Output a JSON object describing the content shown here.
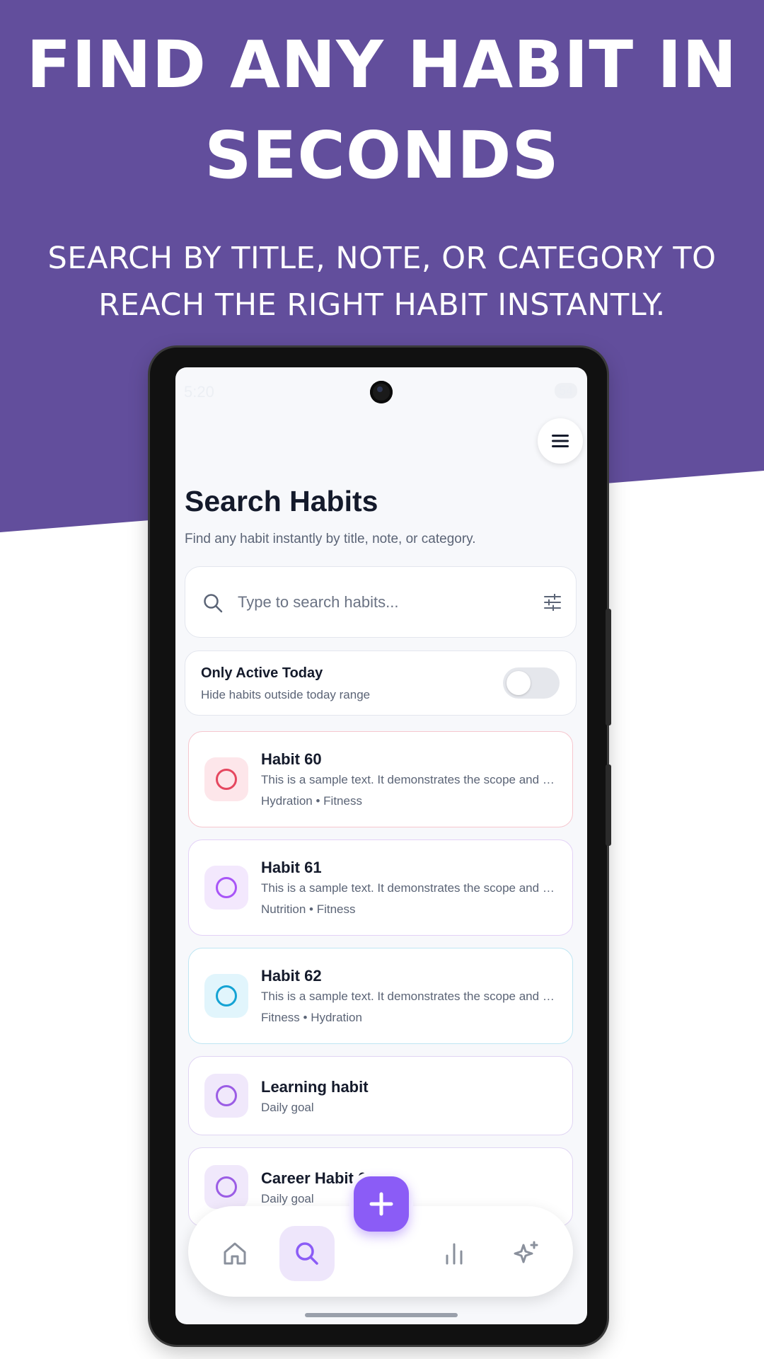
{
  "hero": {
    "title_line1": "FIND ANY HABIT IN",
    "title_line2": "SECONDS",
    "subtitle_line1": "SEARCH BY TITLE, NOTE, OR CATEGORY TO",
    "subtitle_line2": "REACH THE RIGHT HABIT INSTANTLY."
  },
  "status_bar": {
    "time": "5:20",
    "battery": "54"
  },
  "screen": {
    "title": "Search Habits",
    "subtitle": "Find any habit instantly by title, note, or category."
  },
  "search": {
    "value": "",
    "placeholder": "Type to search habits..."
  },
  "filter": {
    "title": "Only Active Today",
    "subtitle": "Hide habits outside today range",
    "enabled": false
  },
  "habits": [
    {
      "title": "Habit 60",
      "description": "This is a sample text. It demonstrates the scope and purpose of this habit.",
      "tags": "Hydration • Fitness",
      "accent": "#e5475f",
      "badge_bg": "#fde6ea",
      "border": "#f6c6ce"
    },
    {
      "title": "Habit 61",
      "description": "This is a sample text. It demonstrates the scope and purpose of this habit.",
      "tags": "Nutrition • Fitness",
      "accent": "#a855f7",
      "badge_bg": "#f3e8fd",
      "border": "#e3d2f7"
    },
    {
      "title": "Habit 62",
      "description": "This is a sample text. It demonstrates the scope and purpose of this habit.",
      "tags": "Fitness • Hydration",
      "accent": "#14a3d4",
      "badge_bg": "#e1f5fc",
      "border": "#bfe6f3"
    },
    {
      "title": "Learning habit",
      "description": "Daily goal",
      "accent": "#9b5de5",
      "badge_bg": "#f0e8fb",
      "border": "#e0d5f3"
    },
    {
      "title": "Career Habit 6",
      "description": "Daily goal",
      "accent": "#9b5de5",
      "badge_bg": "#f0e8fb",
      "border": "#e0d5f3"
    }
  ],
  "nav": {
    "items": [
      "home-icon",
      "search-icon",
      "chart-icon",
      "sparkles-icon"
    ],
    "active": "search-icon",
    "accent": "#8b5cf6"
  },
  "colors": {
    "hero_bg": "#624e9c",
    "accent": "#8b5cf6"
  }
}
